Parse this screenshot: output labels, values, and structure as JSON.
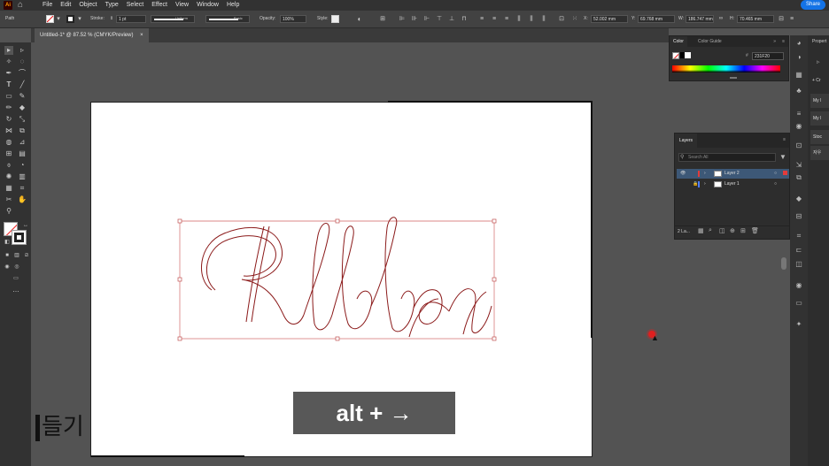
{
  "app": {
    "logo": "Ai",
    "home_icon": "home-icon"
  },
  "menu": [
    "File",
    "Edit",
    "Object",
    "Type",
    "Select",
    "Effect",
    "View",
    "Window",
    "Help"
  ],
  "share_label": "Share",
  "control_bar": {
    "selection_type": "Path",
    "stroke_label": "Stroke:",
    "stroke_weight": "1 pt",
    "profile": "Uniform",
    "brush": "Basic",
    "opacity_label": "Opacity:",
    "opacity_value": "100%",
    "style_label": "Style:",
    "x_label": "X:",
    "x_value": "52.002 mm",
    "y_label": "Y:",
    "y_value": "69.768 mm",
    "w_label": "W:",
    "w_value": "186.747 mm",
    "h_label": "H:",
    "h_value": "70.465 mm"
  },
  "document_tab": "Untitled-1* @ 87.52 % (CMYK/Preview)",
  "document_tab_close": "×",
  "color_panel": {
    "tabs": [
      "Color",
      "Color Guide"
    ],
    "hex_value": "231F20"
  },
  "layers_panel": {
    "title": "Layers",
    "search_placeholder": "Search All",
    "layers": [
      {
        "name": "Layer 2",
        "color": "#e23b3b",
        "visible": true,
        "selected": true
      },
      {
        "name": "Layer 1",
        "color": "#4f7cff",
        "visible": false,
        "selected": false
      }
    ],
    "footer_count": "2 La..."
  },
  "properties_panel": {
    "title": "Propert",
    "items": [
      "+ Cr",
      "My l",
      "My l",
      "Stoc",
      "자우"
    ]
  },
  "canvas": {
    "overlay_text": "alt + →",
    "side_text": "들기"
  },
  "colors": {
    "accent": "#1473e6",
    "path_stroke": "#8b1a1a",
    "bounding_box": "#d77a7a"
  }
}
